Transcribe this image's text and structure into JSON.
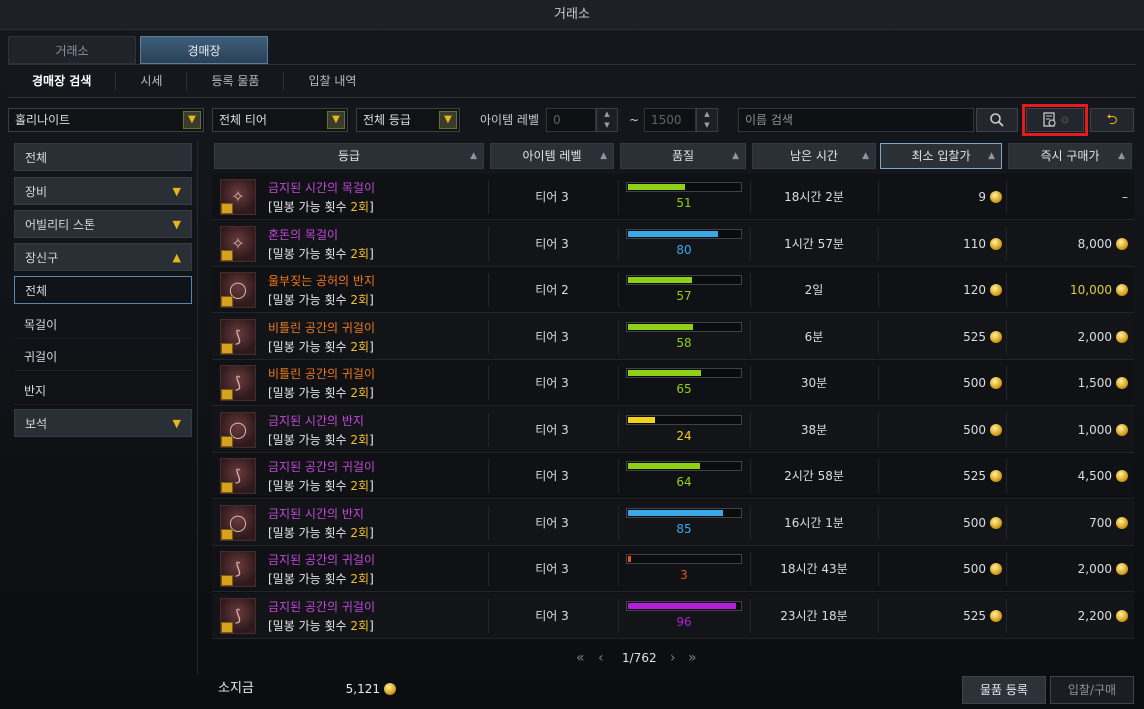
{
  "window": {
    "title": "거래소"
  },
  "tabs": [
    {
      "label": "거래소",
      "active": false
    },
    {
      "label": "경매장",
      "active": true
    }
  ],
  "subtabs": [
    {
      "label": "경매장 검색",
      "active": true
    },
    {
      "label": "시세",
      "active": false
    },
    {
      "label": "등록 물품",
      "active": false
    },
    {
      "label": "입찰 내역",
      "active": false
    }
  ],
  "filters": {
    "server": "홀리나이트",
    "tier": "전체 티어",
    "grade": "전체 등급",
    "level_label": "아이템 레벨",
    "level_min_placeholder": "0",
    "level_max_placeholder": "1500",
    "tilde": "~",
    "search_placeholder": "이름 검색"
  },
  "sidebar": {
    "items": [
      {
        "label": "전체",
        "type": "category"
      },
      {
        "label": "장비",
        "type": "category",
        "chevron": "▼"
      },
      {
        "label": "어빌리티 스톤",
        "type": "category",
        "chevron": "▼"
      },
      {
        "label": "장신구",
        "type": "category",
        "chevron": "▲"
      },
      {
        "label": "전체",
        "type": "selected"
      },
      {
        "label": "목걸이",
        "type": "sub"
      },
      {
        "label": "귀걸이",
        "type": "sub"
      },
      {
        "label": "반지",
        "type": "sub"
      },
      {
        "label": "보석",
        "type": "category",
        "chevron": "▼"
      }
    ]
  },
  "table": {
    "headers": [
      "등급",
      "아이템 레벨",
      "품질",
      "남은 시간",
      "최소 입찰가",
      "즉시 구매가"
    ],
    "sub_prefix": "[밀봉 가능 횟수 ",
    "sub_count": "2회",
    "sub_suffix": "]",
    "rows": [
      {
        "name": "금지된 시간의 목걸이",
        "color": "purple",
        "glyph": "✧",
        "tier": "티어 3",
        "quality": 51,
        "quality_color": "#8fd014",
        "remaining": "18시간 2분",
        "min_bid": "9",
        "buy_now": "–",
        "buy_now_yellow": false
      },
      {
        "name": "혼돈의 목걸이",
        "color": "purple",
        "glyph": "✧",
        "tier": "티어 3",
        "quality": 80,
        "quality_color": "#3aa8e6",
        "remaining": "1시간 57분",
        "min_bid": "110",
        "buy_now": "8,000",
        "buy_now_yellow": false
      },
      {
        "name": "울부짖는 공허의 반지",
        "color": "orange",
        "glyph": "◯",
        "tier": "티어 2",
        "quality": 57,
        "quality_color": "#8fd014",
        "remaining": "2일",
        "min_bid": "120",
        "buy_now": "10,000",
        "buy_now_yellow": true
      },
      {
        "name": "비틀린 공간의 귀걸이",
        "color": "orange",
        "glyph": "⟆",
        "tier": "티어 3",
        "quality": 58,
        "quality_color": "#8fd014",
        "remaining": "6분",
        "min_bid": "525",
        "buy_now": "2,000",
        "buy_now_yellow": false
      },
      {
        "name": "비틀린 공간의 귀걸이",
        "color": "orange",
        "glyph": "⟆",
        "tier": "티어 3",
        "quality": 65,
        "quality_color": "#8fd014",
        "remaining": "30분",
        "min_bid": "500",
        "buy_now": "1,500",
        "buy_now_yellow": false
      },
      {
        "name": "금지된 시간의 반지",
        "color": "purple",
        "glyph": "◯",
        "tier": "티어 3",
        "quality": 24,
        "quality_color": "#f2d21c",
        "remaining": "38분",
        "min_bid": "500",
        "buy_now": "1,000",
        "buy_now_yellow": false
      },
      {
        "name": "금지된 공간의 귀걸이",
        "color": "purple",
        "glyph": "⟆",
        "tier": "티어 3",
        "quality": 64,
        "quality_color": "#8fd014",
        "remaining": "2시간 58분",
        "min_bid": "525",
        "buy_now": "4,500",
        "buy_now_yellow": false
      },
      {
        "name": "금지된 시간의 반지",
        "color": "purple",
        "glyph": "◯",
        "tier": "티어 3",
        "quality": 85,
        "quality_color": "#3aa8e6",
        "remaining": "16시간 1분",
        "min_bid": "500",
        "buy_now": "700",
        "buy_now_yellow": false
      },
      {
        "name": "금지된 공간의 귀걸이",
        "color": "purple",
        "glyph": "⟆",
        "tier": "티어 3",
        "quality": 3,
        "quality_color": "#e0541c",
        "remaining": "18시간 43분",
        "min_bid": "500",
        "buy_now": "2,000",
        "buy_now_yellow": false
      },
      {
        "name": "금지된 공간의 귀걸이",
        "color": "purple",
        "glyph": "⟆",
        "tier": "티어 3",
        "quality": 96,
        "quality_color": "#b21fd6",
        "remaining": "23시간 18분",
        "min_bid": "525",
        "buy_now": "2,200",
        "buy_now_yellow": false
      }
    ]
  },
  "pager": {
    "current": "1/762"
  },
  "footer": {
    "gold_label": "소지금",
    "gold_value": "5,121",
    "register_label": "물품 등록",
    "bid_label": "입찰/구매"
  },
  "icons": {
    "search": "search-icon",
    "filter": "advanced-search-icon",
    "reset": "reset-icon",
    "coin": "gold-coin-icon"
  }
}
